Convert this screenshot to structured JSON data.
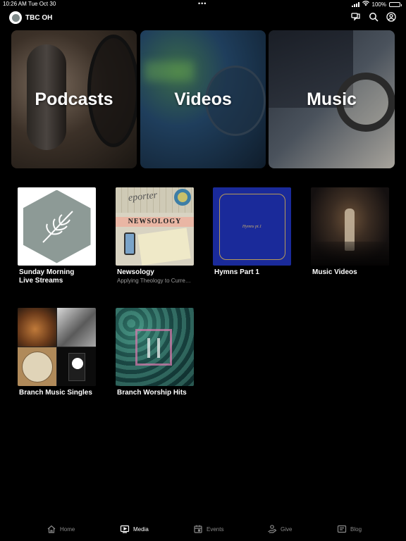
{
  "status_bar": {
    "time": "10:26 AM",
    "date": "Tue Oct 30",
    "dots": "•••",
    "battery": "100%"
  },
  "header": {
    "org_name": "TBC OH"
  },
  "hero_cards": [
    {
      "label": "Podcasts"
    },
    {
      "label": "Videos"
    },
    {
      "label": "Music"
    }
  ],
  "media_items": [
    {
      "title": "Sunday Morning\nLive Streams",
      "subtitle": ""
    },
    {
      "title": "Newsology",
      "subtitle": "Applying Theology to Curre…",
      "art_heading": "eporter",
      "art_banner": "NEWSOLOGY"
    },
    {
      "title": "Hymns Part 1",
      "subtitle": "",
      "art_text": "Hymns pt.1"
    },
    {
      "title": "Music Videos",
      "subtitle": ""
    },
    {
      "title": "Branch Music Singles",
      "subtitle": ""
    },
    {
      "title": "Branch Worship Hits",
      "subtitle": ""
    }
  ],
  "tabs": [
    {
      "label": "Home",
      "icon": "home-icon",
      "active": false
    },
    {
      "label": "Media",
      "icon": "media-icon",
      "active": true
    },
    {
      "label": "Events",
      "icon": "calendar-icon",
      "active": false
    },
    {
      "label": "Give",
      "icon": "give-icon",
      "active": false
    },
    {
      "label": "Blog",
      "icon": "blog-icon",
      "active": false
    }
  ],
  "colors": {
    "background": "#000000",
    "text": "#ffffff",
    "inactive_tab": "#8a8a8a",
    "subtitle": "#9a9a9a"
  }
}
